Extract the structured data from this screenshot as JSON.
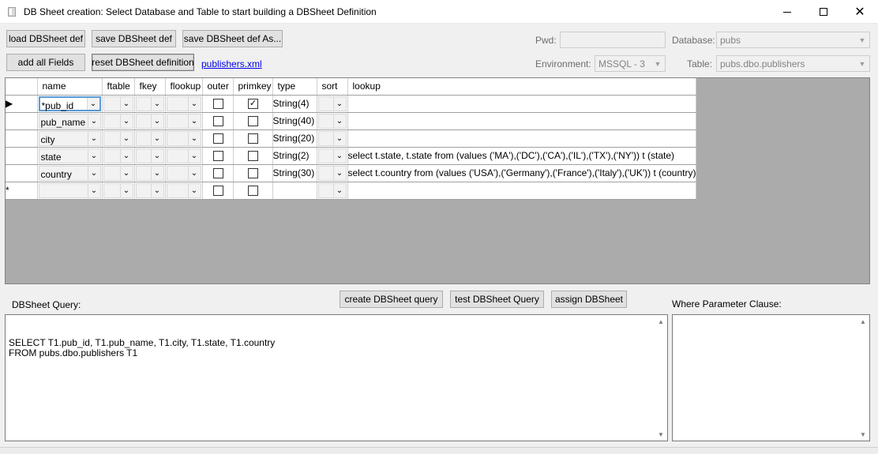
{
  "window": {
    "title": "DB Sheet creation: Select Database and Table to start building a DBSheet Definition",
    "minimize_symbol": "—",
    "close_symbol": "✕"
  },
  "toolbar": {
    "load_label": "load DBSheet def",
    "save_label": "save DBSheet def",
    "save_as_label": "save DBSheet def As...",
    "add_all_label": "add all Fields",
    "reset_label": "reset DBSheet definition",
    "file_link": "publishers.xml"
  },
  "connection": {
    "pwd_label": "Pwd:",
    "pwd_value": "",
    "database_label": "Database:",
    "database_value": "pubs",
    "environment_label": "Environment:",
    "environment_value": "MSSQL - 3",
    "table_label": "Table:",
    "table_value": "pubs.dbo.publishers"
  },
  "grid": {
    "columns": [
      "name",
      "ftable",
      "fkey",
      "flookup",
      "outer",
      "primkey",
      "type",
      "sort",
      "lookup"
    ],
    "rows": [
      {
        "indicator": "▶",
        "name": "*pub_id",
        "outer": false,
        "primkey": true,
        "type": "String(4)",
        "lookup": ""
      },
      {
        "indicator": "",
        "name": "pub_name",
        "outer": false,
        "primkey": false,
        "type": "String(40)",
        "lookup": ""
      },
      {
        "indicator": "",
        "name": "city",
        "outer": false,
        "primkey": false,
        "type": "String(20)",
        "lookup": ""
      },
      {
        "indicator": "",
        "name": "state",
        "outer": false,
        "primkey": false,
        "type": "String(2)",
        "lookup": "select t.state, t.state from (values ('MA'),('DC'),('CA'),('IL'),('TX'),('NY')) t (state)"
      },
      {
        "indicator": "",
        "name": "country",
        "outer": false,
        "primkey": false,
        "type": "String(30)",
        "lookup": "select t.country from (values ('USA'),('Germany'),('France'),('Italy'),('UK')) t (country)"
      },
      {
        "indicator": "*",
        "name": "",
        "outer": false,
        "primkey": false,
        "type": "",
        "lookup": ""
      }
    ]
  },
  "actions": {
    "create_query_label": "create DBSheet query",
    "test_query_label": "test DBSheet Query",
    "assign_label": "assign DBSheet"
  },
  "query": {
    "label": "DBSheet Query:",
    "text": "SELECT T1.pub_id, T1.pub_name, T1.city, T1.state, T1.country\nFROM pubs.dbo.publishers T1"
  },
  "where": {
    "label": "Where Parameter Clause:",
    "text": ""
  }
}
